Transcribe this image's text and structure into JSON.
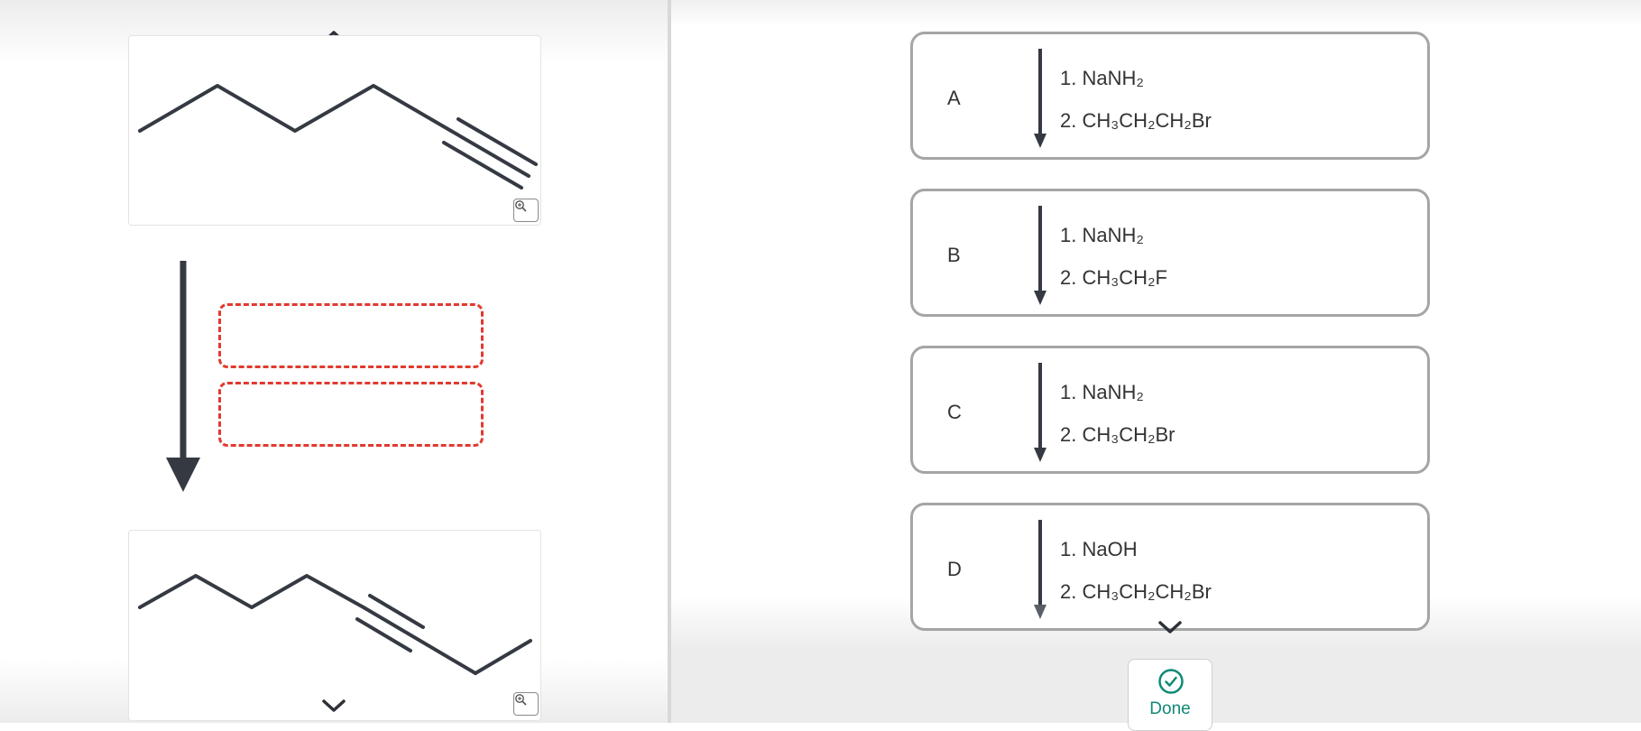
{
  "colors": {
    "drop_zone_border": "#e03a2f",
    "done_accent": "#0f8a76",
    "bond": "#353a42",
    "card_border": "#a5a5a5"
  },
  "left_panel": {
    "reactant_icon": "molecule-hex-1-yne",
    "product_icon": "molecule-oct-3-yne",
    "zoom_icon": "magnifier-plus-icon",
    "scroll_up_icon": "chevron-up-icon",
    "scroll_down_icon": "chevron-down-icon",
    "reaction_arrow_icon": "down-arrow-icon",
    "drop_zones": [
      {
        "label": ""
      },
      {
        "label": ""
      }
    ]
  },
  "options": [
    {
      "letter": "A",
      "step1": "1. NaNH₂",
      "step2": "2. CH₃CH₂CH₂Br"
    },
    {
      "letter": "B",
      "step1": "1. NaNH₂",
      "step2": "2. CH₃CH₂F"
    },
    {
      "letter": "C",
      "step1": "1. NaNH₂",
      "step2": "2. CH₃CH₂Br"
    },
    {
      "letter": "D",
      "step1": "1. NaOH",
      "step2": "2. CH₃CH₂CH₂Br"
    }
  ],
  "footer": {
    "done_label": "Done",
    "done_icon": "check-circle-icon",
    "scroll_down_icon": "chevron-down-icon"
  }
}
